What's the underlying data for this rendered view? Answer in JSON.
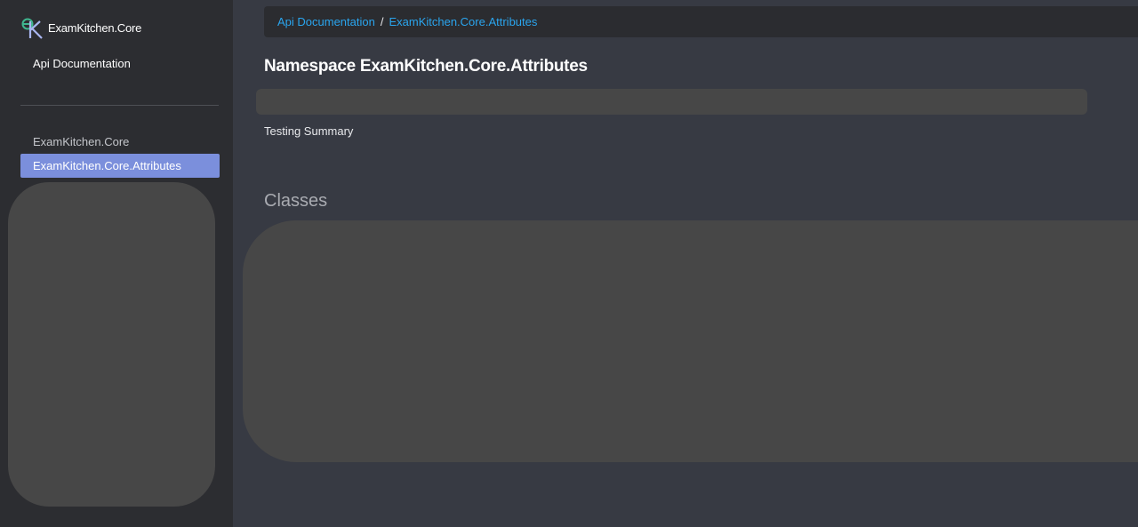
{
  "brand": {
    "name": "ExamKitchen.Core",
    "logo_icon": "ek-logo-icon"
  },
  "sidebar": {
    "home_link": "Api Documentation",
    "namespaces": [
      {
        "label": "ExamKitchen.Core",
        "active": false
      },
      {
        "label": "ExamKitchen.Core.Attributes",
        "active": true
      }
    ]
  },
  "breadcrumb": {
    "items": [
      "Api Documentation",
      "ExamKitchen.Core.Attributes"
    ],
    "separator": "/"
  },
  "main": {
    "title": "Namespace ExamKitchen.Core.Attributes",
    "summary": "Testing Summary",
    "classes_heading": "Classes"
  },
  "colors": {
    "background": "#373a43",
    "sidebar": "#2c2d31",
    "accent_active": "#7b8fdc",
    "link": "#2aa5ee",
    "placeholder": "#474747"
  }
}
